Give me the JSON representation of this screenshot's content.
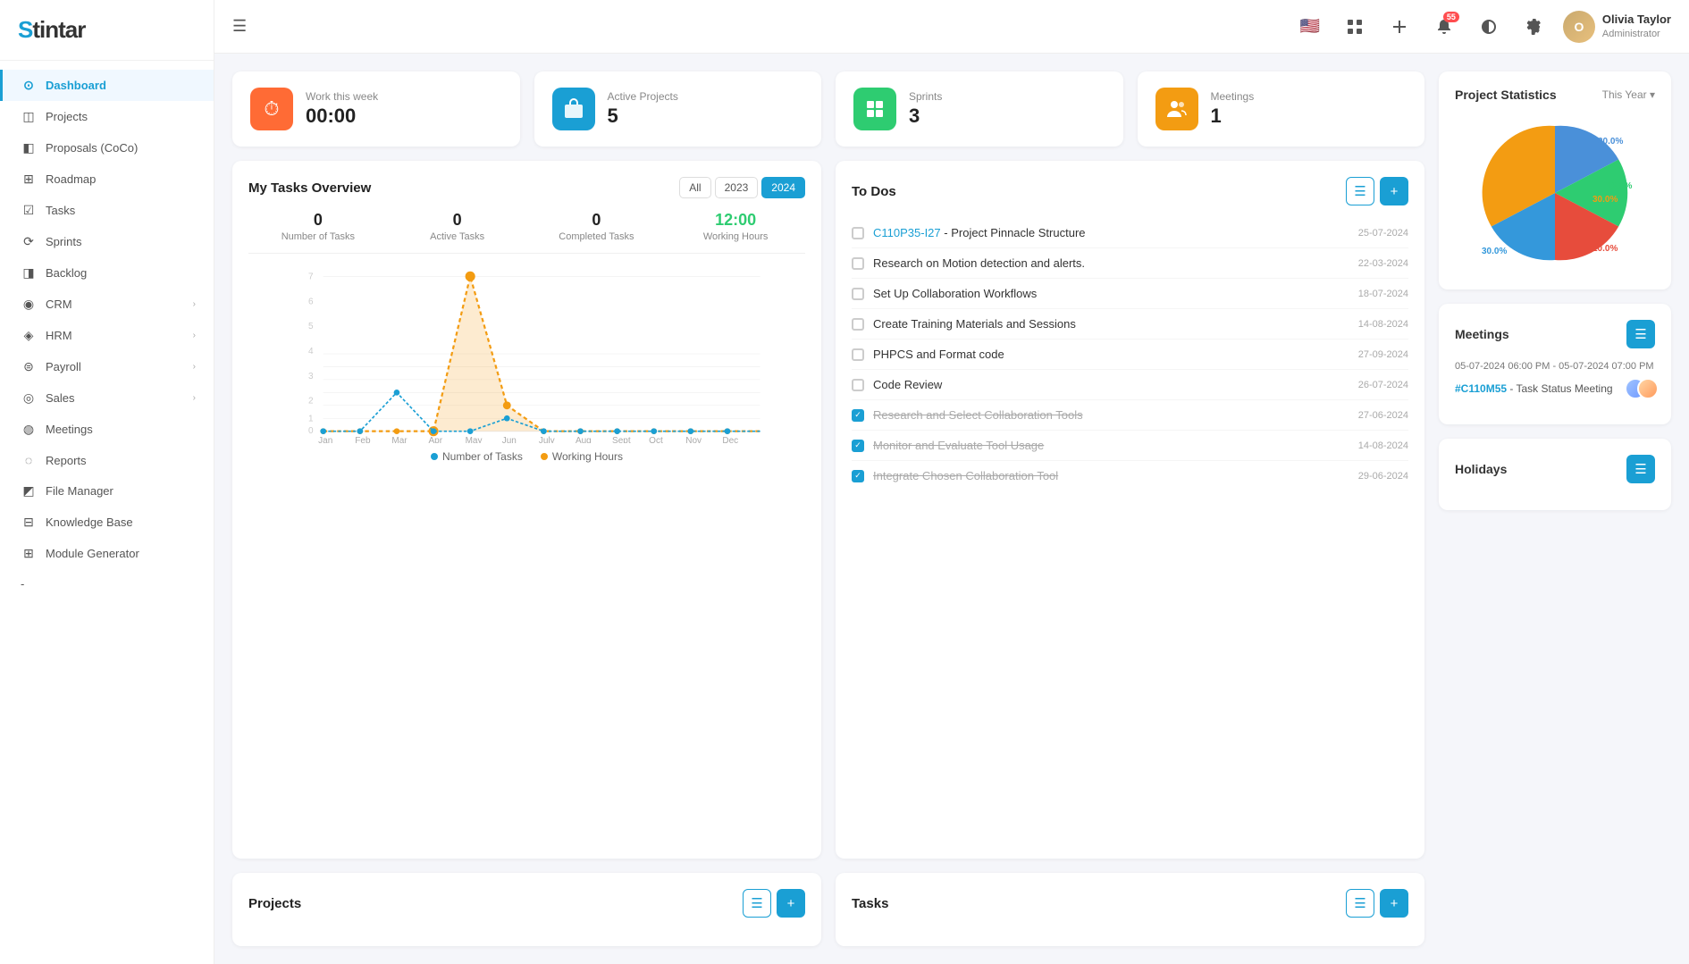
{
  "app": {
    "logo": "Stintar",
    "logo_s": "S",
    "logo_rest": "tintar"
  },
  "topbar": {
    "menu_icon": "☰",
    "notifications_count": "55",
    "user_name": "Olivia Taylor",
    "user_role": "Administrator",
    "year_filter": "This Year"
  },
  "sidebar": {
    "items": [
      {
        "id": "dashboard",
        "label": "Dashboard",
        "icon": "⊙",
        "active": true
      },
      {
        "id": "projects",
        "label": "Projects",
        "icon": "◫"
      },
      {
        "id": "proposals",
        "label": "Proposals (CoCo)",
        "icon": "◧"
      },
      {
        "id": "roadmap",
        "label": "Roadmap",
        "icon": "⊞"
      },
      {
        "id": "tasks",
        "label": "Tasks",
        "icon": "☑"
      },
      {
        "id": "sprints",
        "label": "Sprints",
        "icon": "⟳"
      },
      {
        "id": "backlog",
        "label": "Backlog",
        "icon": "◨"
      },
      {
        "id": "crm",
        "label": "CRM",
        "icon": "◉",
        "arrow": "›"
      },
      {
        "id": "hrm",
        "label": "HRM",
        "icon": "◈",
        "arrow": "›"
      },
      {
        "id": "payroll",
        "label": "Payroll",
        "icon": "⊜",
        "arrow": "›"
      },
      {
        "id": "sales",
        "label": "Sales",
        "icon": "◎",
        "arrow": "›"
      },
      {
        "id": "meetings",
        "label": "Meetings",
        "icon": "◍"
      },
      {
        "id": "reports",
        "label": "Reports",
        "icon": "◌"
      },
      {
        "id": "filemanager",
        "label": "File Manager",
        "icon": "◩"
      },
      {
        "id": "knowledgebase",
        "label": "Knowledge Base",
        "icon": "⊟"
      },
      {
        "id": "modulegenerator",
        "label": "Module Generator",
        "icon": "⊞"
      }
    ]
  },
  "stats_cards": [
    {
      "id": "work-this-week",
      "label1": "Work this",
      "label2": "week",
      "value": "00:00",
      "icon": "⏱",
      "icon_class": "icon-orange"
    },
    {
      "id": "active-projects",
      "label1": "Active",
      "label2": "Projects",
      "value": "5",
      "icon": "💼",
      "icon_class": "icon-blue"
    },
    {
      "id": "sprints",
      "label1": "Sprints",
      "label2": "",
      "value": "3",
      "icon": "▦",
      "icon_class": "icon-green"
    },
    {
      "id": "meetings",
      "label1": "Meetings",
      "label2": "",
      "value": "1",
      "icon": "👥",
      "icon_class": "icon-yellow"
    }
  ],
  "tasks_overview": {
    "title": "My Tasks Overview",
    "tabs": [
      "All",
      "2023",
      "2024"
    ],
    "active_tab": "2024",
    "stats": [
      {
        "num": "0",
        "label": "Number of Tasks"
      },
      {
        "num": "0",
        "label": "Active Tasks"
      },
      {
        "num": "0",
        "label": "Completed Tasks"
      },
      {
        "num": "12:00",
        "label": "Working Hours",
        "green": true
      }
    ],
    "chart": {
      "months": [
        "Jan",
        "Feb",
        "Mar",
        "Apr",
        "May",
        "Jun",
        "July",
        "Aug",
        "Sept",
        "Oct",
        "Nov",
        "Dec"
      ],
      "tasks_data": [
        0,
        0,
        3,
        0,
        0,
        0,
        0,
        0,
        0,
        0,
        0,
        0
      ],
      "hours_data": [
        0,
        0,
        0,
        0,
        7,
        2.5,
        0,
        0,
        0,
        0,
        0,
        0
      ]
    },
    "legend": [
      {
        "label": "Number of Tasks",
        "color": "#1a9fd4"
      },
      {
        "label": "Working Hours",
        "color": "#f39c12"
      }
    ]
  },
  "todos": {
    "title": "To Dos",
    "items": [
      {
        "id": "t1",
        "link": "C110P35-I27",
        "text": "- Project Pinnacle Structure",
        "date": "25-07-2024",
        "checked": false
      },
      {
        "id": "t2",
        "text": "Research on Motion detection and alerts.",
        "date": "22-03-2024",
        "checked": false
      },
      {
        "id": "t3",
        "text": "Set Up Collaboration Workflows",
        "date": "18-07-2024",
        "checked": false
      },
      {
        "id": "t4",
        "text": "Create Training Materials and Sessions",
        "date": "14-08-2024",
        "checked": false
      },
      {
        "id": "t5",
        "text": "PHPCS and Format code",
        "date": "27-09-2024",
        "checked": false
      },
      {
        "id": "t6",
        "text": "Code Review",
        "date": "26-07-2024",
        "checked": false
      },
      {
        "id": "t7",
        "text": "Research and Select Collaboration Tools",
        "date": "27-06-2024",
        "checked": true
      },
      {
        "id": "t8",
        "text": "Monitor and Evaluate Tool Usage",
        "date": "14-08-2024",
        "checked": true
      },
      {
        "id": "t9",
        "text": "Integrate Chosen Collaboration Tool",
        "date": "29-06-2024",
        "checked": true
      }
    ]
  },
  "project_statistics": {
    "title": "Project Statistics",
    "year_label": "This Year",
    "segments": [
      {
        "label": "20.0%",
        "value": 20,
        "color": "#4a90d9"
      },
      {
        "label": "10.0%",
        "value": 10,
        "color": "#2ecc71"
      },
      {
        "label": "10.0%",
        "value": 10,
        "color": "#e74c3c"
      },
      {
        "label": "30.0%",
        "value": 30,
        "color": "#3498db"
      },
      {
        "label": "30.0%",
        "value": 30,
        "color": "#f39c12"
      }
    ]
  },
  "meetings_panel": {
    "title": "Meetings",
    "items": [
      {
        "time": "05-07-2024 06:00 PM - 05-07-2024 07:00 PM",
        "link": "#C110M55",
        "desc": "- Task Status Meeting"
      }
    ]
  },
  "projects_section": {
    "title": "Projects"
  },
  "tasks_section": {
    "title": "Tasks"
  },
  "holidays_section": {
    "title": "Holidays"
  }
}
